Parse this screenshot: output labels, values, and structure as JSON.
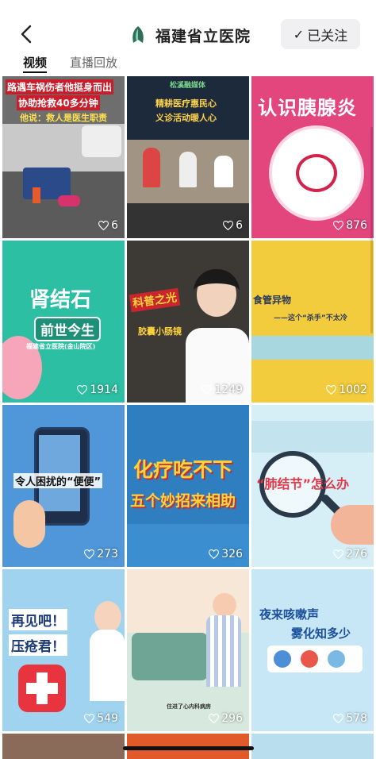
{
  "header": {
    "back_icon": "chevron-left-icon",
    "logo_icon": "hospital-logo-icon",
    "title": "福建省立医院",
    "follow_check": "✓",
    "follow_label": "已关注"
  },
  "tabs": [
    {
      "label": "视频",
      "active": true
    },
    {
      "label": "直播回放",
      "active": false
    }
  ],
  "videos": [
    {
      "title": "路遇车祸伤者他挺身而出",
      "subtitle": "协助抢救40多分钟",
      "caption": "他说：救人是医生职责",
      "count": "6",
      "bg": "#6e6e6e"
    },
    {
      "title": "松溪融媒体",
      "subtitle": "精耕医疗惠民心",
      "caption": "义诊活动暖人心",
      "count": "6",
      "bg": "#8a7d6c"
    },
    {
      "title": "认识胰腺炎",
      "subtitle": "",
      "caption": "",
      "count": "876",
      "bg": "#e2467d"
    },
    {
      "title": "肾结石",
      "subtitle": "前世今生",
      "caption": "福建省立医院(金山院区)",
      "count": "1914",
      "bg": "#2cbfa3"
    },
    {
      "title": "科普之光",
      "subtitle": "胶囊小肠镜",
      "caption": "",
      "count": "1249",
      "bg": "#3d3a36"
    },
    {
      "title": "食管异物",
      "subtitle": "——这个“杀手”不太冷",
      "caption": "",
      "count": "1002",
      "bg": "#f2cc3c"
    },
    {
      "title": "令人困扰的“便便”",
      "subtitle": "",
      "caption": "",
      "count": "273",
      "bg": "#4f97d8"
    },
    {
      "title": "化疗吃不下",
      "subtitle": "五个妙招来相助",
      "caption": "",
      "count": "326",
      "bg": "#2f7fc0"
    },
    {
      "title": "“肺结节”怎么办",
      "subtitle": "",
      "caption": "",
      "count": "276",
      "bg": "#d6eef5"
    },
    {
      "title": "再见吧！",
      "subtitle": "压疮君！",
      "caption": "",
      "count": "549",
      "bg": "#9fd3ef"
    },
    {
      "title": "",
      "subtitle": "住进了心内科病房",
      "caption": "",
      "count": "296",
      "bg": "#d7e8de"
    },
    {
      "title": "夜来咳嗽声",
      "subtitle": "雾化知多少",
      "caption": "",
      "count": "578",
      "bg": "#c8e7f6"
    }
  ]
}
